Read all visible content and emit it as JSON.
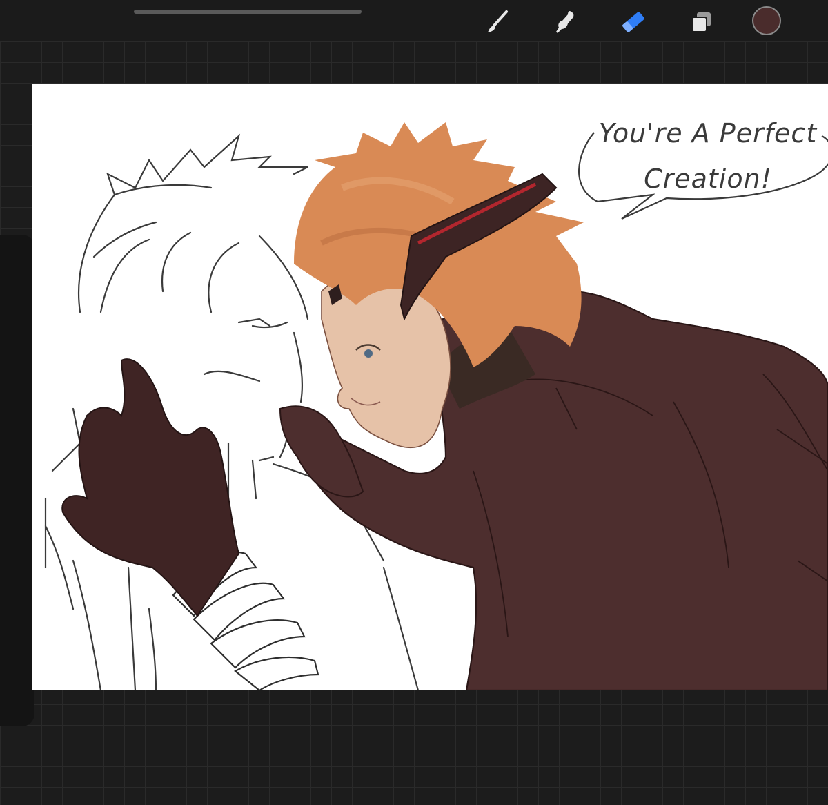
{
  "toolbar": {
    "tools": [
      {
        "name": "brush",
        "icon": "brush-icon"
      },
      {
        "name": "smudge",
        "icon": "smudge-icon"
      },
      {
        "name": "eraser",
        "icon": "eraser-icon",
        "active": true
      },
      {
        "name": "layers",
        "icon": "layers-icon"
      }
    ],
    "active_tool_color": "#2f7df6",
    "current_color": "#4a2c2c"
  },
  "canvas": {
    "speech_bubble": {
      "line1": "You're A Perfect",
      "line2": "Creation!"
    },
    "colors": {
      "hair": "#d98a55",
      "coat": "#4d2e2e",
      "skin": "#e6c2a8",
      "headpiece": "#3d2424",
      "accent": "#b3262e",
      "lineart": "#2e2e2e"
    }
  }
}
